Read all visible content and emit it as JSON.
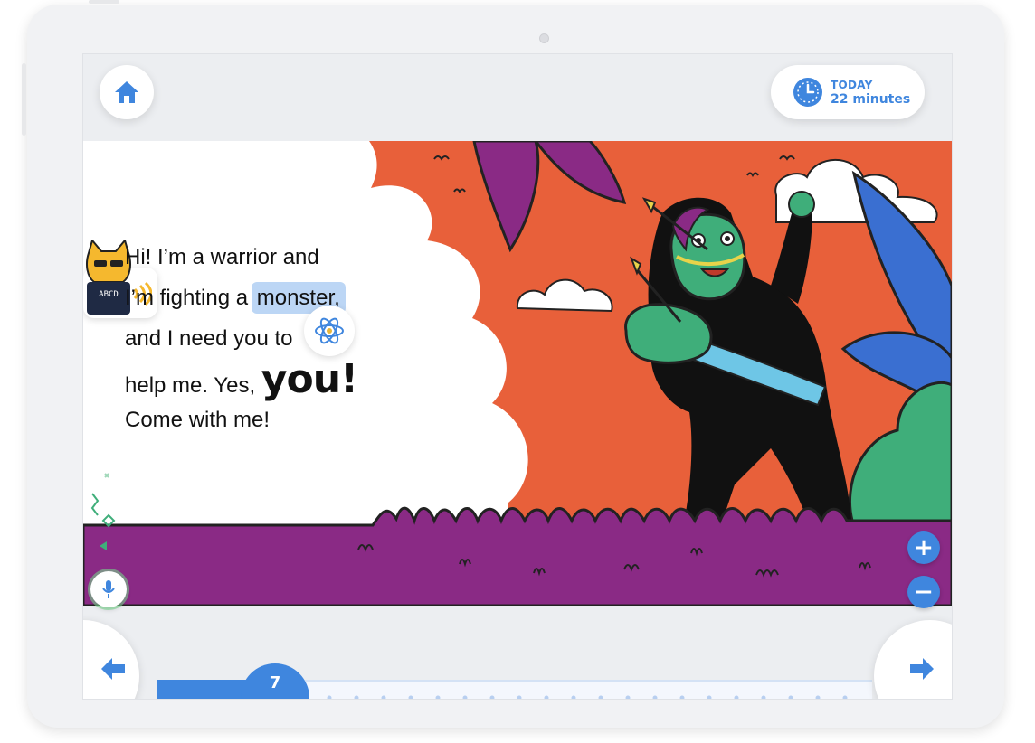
{
  "header": {
    "today_label": "TODAY",
    "today_minutes": "22 minutes"
  },
  "story": {
    "lines": [
      {
        "before": "Hi! I’m a warrior ",
        "hidden_tail": "and"
      },
      {
        "before": "I’m fighting a ",
        "highlight": "monster,"
      },
      {
        "before": "and I need you to"
      },
      {
        "before": "help me. Yes, ",
        "big": "you!"
      },
      {
        "before": "Come with me!"
      }
    ],
    "highlighted_word": "monster,"
  },
  "badge": {
    "caption": "ABCD"
  },
  "zoom": {
    "in_label": "+",
    "out_label": "−"
  },
  "progress": {
    "current_page": "7",
    "fraction_read": 0.13
  },
  "icons": [
    "home-icon",
    "clock-icon",
    "atom-icon",
    "mic-icon",
    "arrow-left-icon",
    "arrow-right-icon",
    "plus-icon",
    "minus-icon",
    "sound-waves-icon",
    "cat-mascot-icon"
  ],
  "colors": {
    "accent": "#3f86de",
    "highlight": "#bcd6f5",
    "sky": "#e8603a",
    "grass": "#8a2a85"
  }
}
